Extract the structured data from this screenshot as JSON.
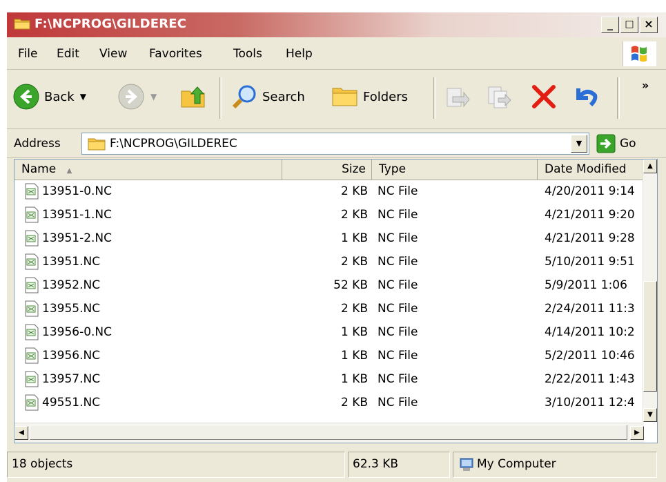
{
  "window": {
    "title": "F:\\NCPROG\\GILDEREC",
    "controls": {
      "minimize": "_",
      "maximize": "□",
      "close": "×"
    }
  },
  "menu": {
    "items": [
      "File",
      "Edit",
      "View",
      "Favorites",
      "Tools",
      "Help"
    ]
  },
  "toolbar": {
    "back_label": "Back",
    "search_label": "Search",
    "folders_label": "Folders",
    "overflow": "»"
  },
  "address": {
    "label": "Address",
    "value": "F:\\NCPROG\\GILDEREC",
    "go_label": "Go"
  },
  "columns": {
    "name": "Name",
    "size": "Size",
    "type": "Type",
    "date": "Date Modified"
  },
  "files": [
    {
      "name": "13951-0.NC",
      "size": "2 KB",
      "type": "NC File",
      "date": "4/20/2011 9:14"
    },
    {
      "name": "13951-1.NC",
      "size": "2 KB",
      "type": "NC File",
      "date": "4/21/2011 9:20"
    },
    {
      "name": "13951-2.NC",
      "size": "1 KB",
      "type": "NC File",
      "date": "4/21/2011 9:28"
    },
    {
      "name": "13951.NC",
      "size": "2 KB",
      "type": "NC File",
      "date": "5/10/2011 9:51"
    },
    {
      "name": "13952.NC",
      "size": "52 KB",
      "type": "NC File",
      "date": "5/9/2011 1:06"
    },
    {
      "name": "13955.NC",
      "size": "2 KB",
      "type": "NC File",
      "date": "2/24/2011 11:3"
    },
    {
      "name": "13956-0.NC",
      "size": "1 KB",
      "type": "NC File",
      "date": "4/14/2011 10:2"
    },
    {
      "name": "13956.NC",
      "size": "1 KB",
      "type": "NC File",
      "date": "5/2/2011 10:46"
    },
    {
      "name": "13957.NC",
      "size": "1 KB",
      "type": "NC File",
      "date": "2/22/2011 1:43"
    },
    {
      "name": "49551.NC",
      "size": "2 KB",
      "type": "NC File",
      "date": "3/10/2011 12:4"
    }
  ],
  "status": {
    "objects": "18 objects",
    "size": "62.3 KB",
    "location": "My Computer"
  },
  "colors": {
    "titlebar_start": "#c0383a",
    "chrome": "#ECE9D8",
    "border": "#7f9db9"
  }
}
